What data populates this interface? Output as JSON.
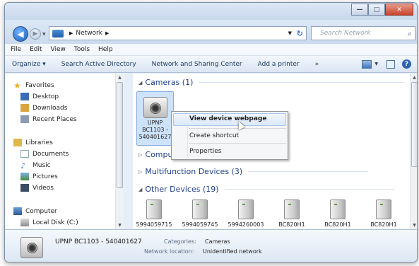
{
  "window": {
    "controls": {
      "minimize": "—",
      "maximize": "□",
      "close": "✕"
    }
  },
  "address": {
    "crumbs": [
      "Network"
    ],
    "search_placeholder": "Search Network"
  },
  "menu": [
    "File",
    "Edit",
    "View",
    "Tools",
    "Help"
  ],
  "toolbar": {
    "organize": "Organize ▾",
    "items": [
      "Search Active Directory",
      "Network and Sharing Center",
      "Add a printer",
      "»"
    ]
  },
  "nav": {
    "favorites": "Favorites",
    "desktop": "Desktop",
    "downloads": "Downloads",
    "recent": "Recent Places",
    "libraries": "Libraries",
    "documents": "Documents",
    "music": "Music",
    "pictures": "Pictures",
    "videos": "Videos",
    "computer": "Computer",
    "localdisk": "Local Disk (C:)"
  },
  "groups": {
    "cameras": "Cameras (1)",
    "computer": "Computer",
    "multifunction": "Multifunction Devices (3)",
    "other": "Other Devices (19)"
  },
  "camera": {
    "line1": "UPNP",
    "line2": "BC1103 -",
    "line3": "540401627"
  },
  "context_menu": {
    "view_webpage": "View device webpage",
    "create_shortcut": "Create shortcut",
    "properties": "Properties"
  },
  "devices": [
    "5994059715",
    "5994059745",
    "5994260003",
    "BC820H1",
    "BC820H1",
    "BC820H1"
  ],
  "details": {
    "name": "UPNP BC1103 - 540401627",
    "categories_label": "Categories:",
    "categories_value": "Cameras",
    "location_label": "Network location:",
    "location_value": "Unidentified network"
  },
  "colors": {
    "accent": "#1e3f8a",
    "selection": "#cde3fa"
  }
}
